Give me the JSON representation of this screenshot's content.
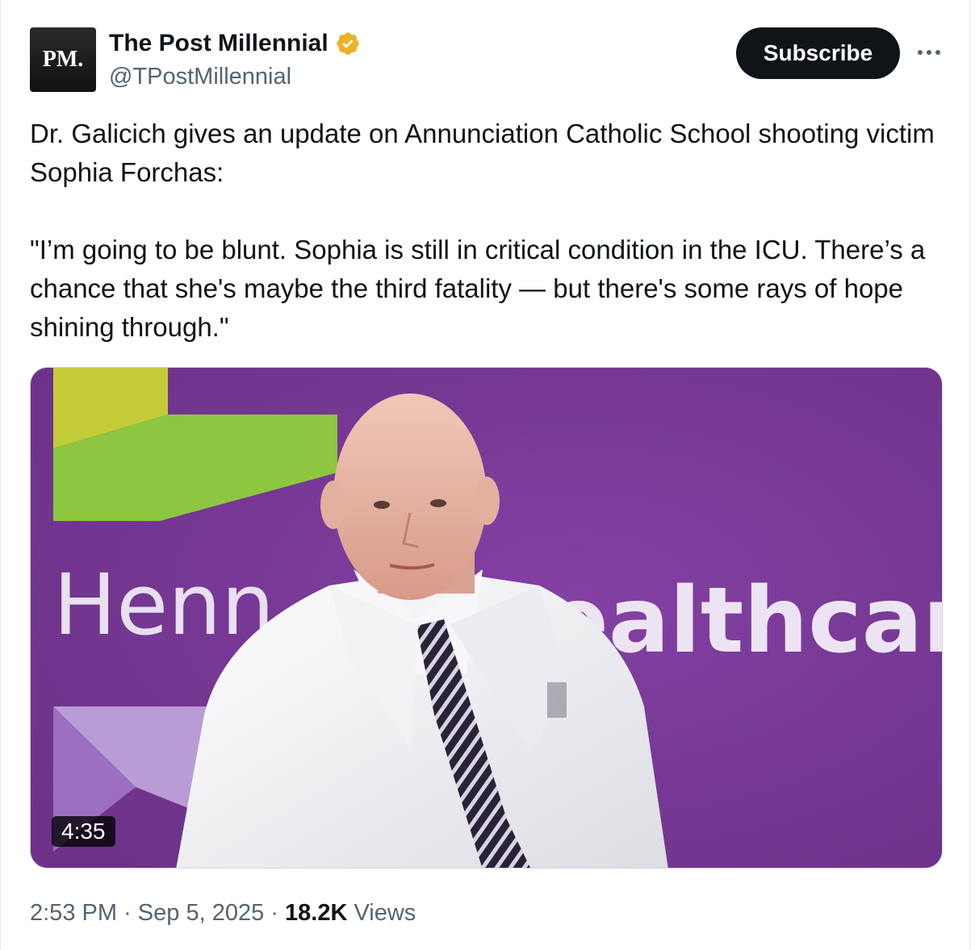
{
  "author": {
    "avatar_text": "PM.",
    "display_name": "The Post Millennial",
    "handle": "@TPostMillennial",
    "verified_color": "#e8b32a"
  },
  "actions": {
    "subscribe_label": "Subscribe"
  },
  "tweet": {
    "paragraph_1": "Dr. Galicich gives an update on Annunciation Catholic School shooting victim Sophia Forchas:",
    "paragraph_2": "\"I’m going to be blunt. Sophia is still in critical condition in the ICU. There’s a chance that she's maybe the third fatality — but there's some rays of hope shining through.\""
  },
  "media": {
    "type": "video",
    "duration": "4:35",
    "backdrop_left_text": "Henn",
    "backdrop_right_text": "ealthcare",
    "background_color": "#7b3a9a"
  },
  "meta": {
    "time": "2:53 PM",
    "separator": "·",
    "date": "Sep 5, 2025",
    "views_count": "18.2K",
    "views_label": "Views"
  }
}
